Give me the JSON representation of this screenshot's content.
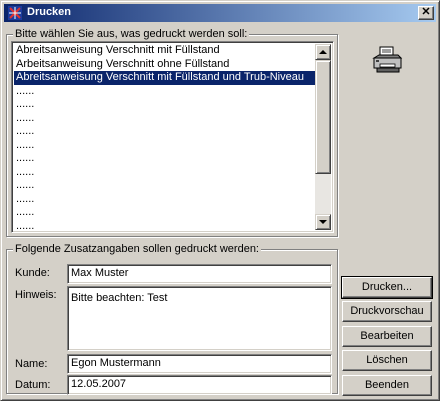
{
  "window": {
    "title": "Drucken",
    "close_label": "✕"
  },
  "select_group": {
    "label": "Bitte wählen Sie aus, was gedruckt werden soll:",
    "items": [
      {
        "label": "Abreitsanweisung Verschnitt mit Füllstand",
        "selected": false
      },
      {
        "label": "Arbeitsanweisung Verschnitt ohne Füllstand",
        "selected": false
      },
      {
        "label": "Abreitsanweisung Verschnitt mit Füllstand und Trub-Niveau",
        "selected": true
      },
      {
        "label": "......",
        "selected": false
      },
      {
        "label": "......",
        "selected": false
      },
      {
        "label": "......",
        "selected": false
      },
      {
        "label": "......",
        "selected": false
      },
      {
        "label": "......",
        "selected": false
      },
      {
        "label": "......",
        "selected": false
      },
      {
        "label": "......",
        "selected": false
      },
      {
        "label": "......",
        "selected": false
      },
      {
        "label": "......",
        "selected": false
      },
      {
        "label": "......",
        "selected": false
      },
      {
        "label": "......",
        "selected": false
      }
    ]
  },
  "extra_group": {
    "label": "Folgende Zusatzangaben sollen gedruckt werden:",
    "kunde_label": "Kunde:",
    "kunde_value": "Max Muster",
    "hinweis_label": "Hinweis:",
    "hinweis_value": "Bitte beachten: Test",
    "name_label": "Name:",
    "name_value": "Egon Mustermann",
    "datum_label": "Datum:",
    "datum_value": "12.05.2007"
  },
  "buttons": {
    "drucken": "Drucken...",
    "druckvorschau": "Druckvorschau",
    "bearbeiten": "Bearbeiten",
    "loeschen": "Löschen",
    "beenden": "Beenden"
  },
  "icons": {
    "title_icon": "app-icon",
    "printer_icon": "printer-icon"
  },
  "colors": {
    "title_start": "#0a246a",
    "title_end": "#a6caf0",
    "selection": "#0a246a",
    "face": "#d4d0c8"
  }
}
